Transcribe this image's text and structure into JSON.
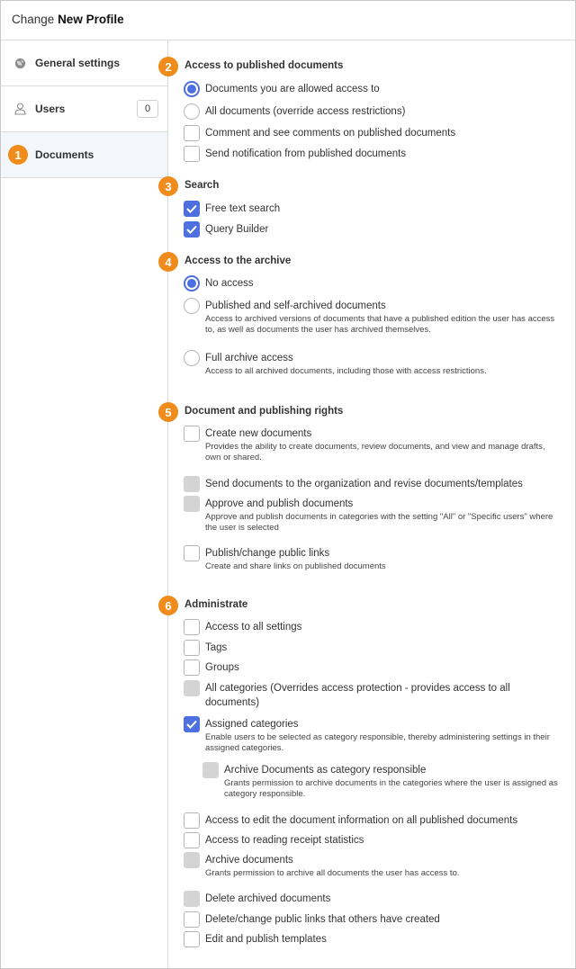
{
  "header": {
    "prefix": "Change",
    "title": "New Profile"
  },
  "sidebar": {
    "items": [
      {
        "label": "General settings",
        "icon": "globe-icon"
      },
      {
        "label": "Users",
        "icon": "user-icon",
        "count": "0"
      },
      {
        "label": "Documents",
        "badge": "1"
      }
    ]
  },
  "colors": {
    "accent": "#4e6fe0",
    "badge": "#f08c1c",
    "disabled": "#d4d4d4"
  },
  "sections": {
    "published": {
      "badge": "2",
      "title": "Access to published documents",
      "options": [
        {
          "label": "Documents you are allowed access to",
          "type": "radio",
          "state": "checked"
        },
        {
          "label": "All documents (override access restrictions)",
          "type": "radio",
          "state": "unchecked"
        },
        {
          "label": "Comment and see comments on published documents",
          "type": "checkbox",
          "state": "unchecked"
        },
        {
          "label": "Send notification from published documents",
          "type": "checkbox",
          "state": "unchecked"
        }
      ]
    },
    "search": {
      "badge": "3",
      "title": "Search",
      "options": [
        {
          "label": "Free text search",
          "type": "checkbox",
          "state": "checked"
        },
        {
          "label": "Query Builder",
          "type": "checkbox",
          "state": "checked"
        }
      ]
    },
    "archive": {
      "badge": "4",
      "title": "Access to the archive",
      "options": [
        {
          "label": "No access",
          "type": "radio",
          "state": "checked"
        },
        {
          "label": "Published and self-archived documents",
          "type": "radio",
          "state": "unchecked",
          "desc": "Access to archived versions of documents that have a published edition the user has access to, as well as documents the user has archived themselves."
        },
        {
          "label": "Full archive access",
          "type": "radio",
          "state": "unchecked",
          "desc": "Access to all archived documents, including those with access restrictions."
        }
      ]
    },
    "rights": {
      "badge": "5",
      "title": "Document and publishing rights",
      "options": [
        {
          "label": "Create new documents",
          "type": "checkbox",
          "state": "unchecked",
          "desc": "Provides the ability to create documents, review documents, and view and manage drafts, own or shared."
        },
        {
          "label": "Send documents to the organization and revise documents/templates",
          "type": "checkbox",
          "state": "disabled"
        },
        {
          "label": "Approve and publish documents",
          "type": "checkbox",
          "state": "disabled",
          "desc": "Approve and publish documents in categories with the setting \"All\" or \"Specific users\" where the user is selected"
        },
        {
          "label": "Publish/change public links",
          "type": "checkbox",
          "state": "unchecked",
          "desc": "Create and share links on published documents"
        }
      ]
    },
    "admin": {
      "badge": "6",
      "title": "Administrate",
      "options": [
        {
          "label": "Access to all settings",
          "type": "checkbox",
          "state": "unchecked"
        },
        {
          "label": "Tags",
          "type": "checkbox",
          "state": "unchecked"
        },
        {
          "label": "Groups",
          "type": "checkbox",
          "state": "unchecked"
        },
        {
          "label": "All categories (Overrides access protection - provides access to all documents)",
          "type": "checkbox",
          "state": "disabled"
        },
        {
          "label": "Assigned categories",
          "type": "checkbox",
          "state": "checked",
          "desc": "Enable users to be selected as category responsible, thereby administering settings in their assigned categories."
        },
        {
          "label": "Archive Documents as category responsible",
          "type": "checkbox",
          "state": "disabled",
          "desc": "Grants permission to archive documents in the categories where the user is assigned as category responsible."
        },
        {
          "label": "Access to edit the document information on all published documents",
          "type": "checkbox",
          "state": "unchecked"
        },
        {
          "label": "Access to reading receipt statistics",
          "type": "checkbox",
          "state": "unchecked"
        },
        {
          "label": "Archive documents",
          "type": "checkbox",
          "state": "disabled",
          "desc": "Grants permission to archive all documents the user has access to."
        },
        {
          "label": "Delete archived documents",
          "type": "checkbox",
          "state": "disabled"
        },
        {
          "label": "Delete/change public links that others have created",
          "type": "checkbox",
          "state": "unchecked"
        },
        {
          "label": "Edit and publish templates",
          "type": "checkbox",
          "state": "unchecked"
        }
      ]
    }
  }
}
